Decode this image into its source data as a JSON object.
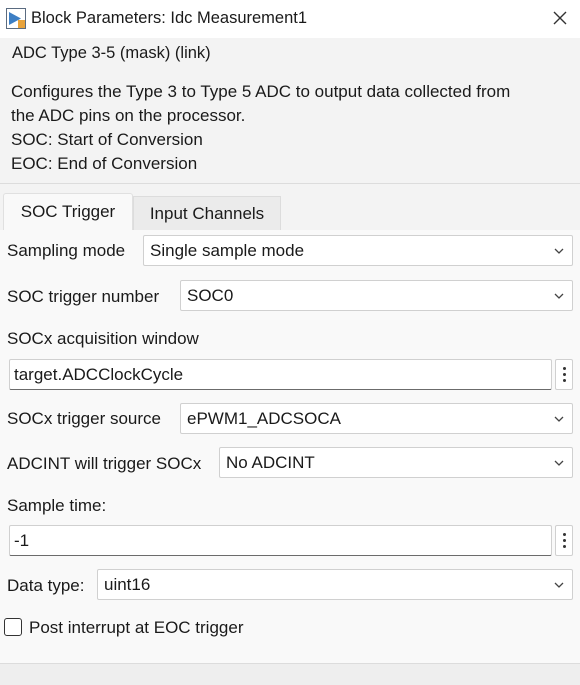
{
  "window": {
    "title": "Block Parameters: Idc Measurement1",
    "icon": "simulink-block-icon",
    "close_icon": "close-icon"
  },
  "description": {
    "mask_line": "ADC Type 3-5 (mask) (link)",
    "lines": [
      "Configures the Type 3 to Type 5 ADC to output data collected from",
      "the ADC pins on the processor.",
      "SOC: Start of Conversion",
      "EOC: End of Conversion"
    ]
  },
  "tabs": [
    {
      "label": "SOC Trigger",
      "active": true
    },
    {
      "label": "Input Channels",
      "active": false
    }
  ],
  "params": {
    "sampling_mode": {
      "label": "Sampling mode",
      "value": "Single sample mode"
    },
    "soc_trigger_number": {
      "label": "SOC trigger number",
      "value": "SOC0"
    },
    "acq_window": {
      "label": "SOCx acquisition window",
      "value": "target.ADCClockCycle"
    },
    "trigger_source": {
      "label": "SOCx trigger source",
      "value": "ePWM1_ADCSOCA"
    },
    "adcint_trigger": {
      "label": "ADCINT will trigger SOCx",
      "value": "No ADCINT"
    },
    "sample_time": {
      "label": "Sample time:",
      "value": "-1"
    },
    "data_type": {
      "label": "Data type:",
      "value": "uint16"
    },
    "post_interrupt": {
      "label": "Post interrupt at EOC trigger",
      "checked": false
    }
  }
}
